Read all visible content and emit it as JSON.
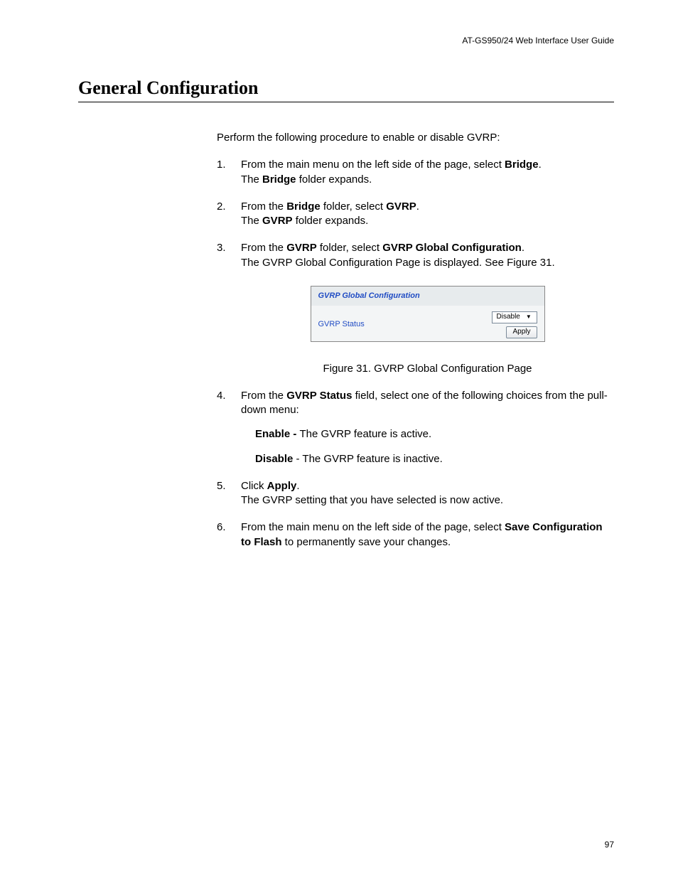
{
  "header": {
    "running": "AT-GS950/24 Web Interface User Guide"
  },
  "title": "General Configuration",
  "intro": "Perform the following procedure to enable or disable GVRP:",
  "steps": {
    "s1": {
      "num": "1.",
      "pre": "From the main menu on the left side of the page, select ",
      "b1": "Bridge",
      "post1": ".",
      "line2a": "The ",
      "line2b": "Bridge",
      "line2c": " folder expands."
    },
    "s2": {
      "num": "2.",
      "pre": "From the ",
      "b1": "Bridge",
      "mid": " folder, select ",
      "b2": "GVRP",
      "post": ".",
      "line2a": "The ",
      "line2b": "GVRP",
      "line2c": " folder expands."
    },
    "s3": {
      "num": "3.",
      "pre": "From the ",
      "b1": "GVRP",
      "mid": " folder, select ",
      "b2": "GVRP Global Configuration",
      "post": ".",
      "line2": "The GVRP Global Configuration Page is displayed. See Figure 31."
    },
    "s4": {
      "num": "4.",
      "pre": "From the ",
      "b1": "GVRP Status",
      "post": " field, select one of the following choices from the pull-down menu:",
      "enable_b": "Enable - ",
      "enable_t": "The GVRP feature is active.",
      "disable_b": "Disable",
      "disable_t": " - The GVRP feature is inactive."
    },
    "s5": {
      "num": "5.",
      "pre": "Click ",
      "b1": "Apply",
      "post": ".",
      "line2": "The GVRP setting that you have selected is now active."
    },
    "s6": {
      "num": "6.",
      "pre": "From the main menu on the left side of the page, select ",
      "b1": "Save Configuration to Flash",
      "post": " to permanently save your changes."
    }
  },
  "figure": {
    "title": "GVRP Global Configuration",
    "row_label": "GVRP Status",
    "select_value": "Disable",
    "button_label": "Apply",
    "caption": "Figure 31. GVRP Global Configuration Page"
  },
  "page_number": "97"
}
